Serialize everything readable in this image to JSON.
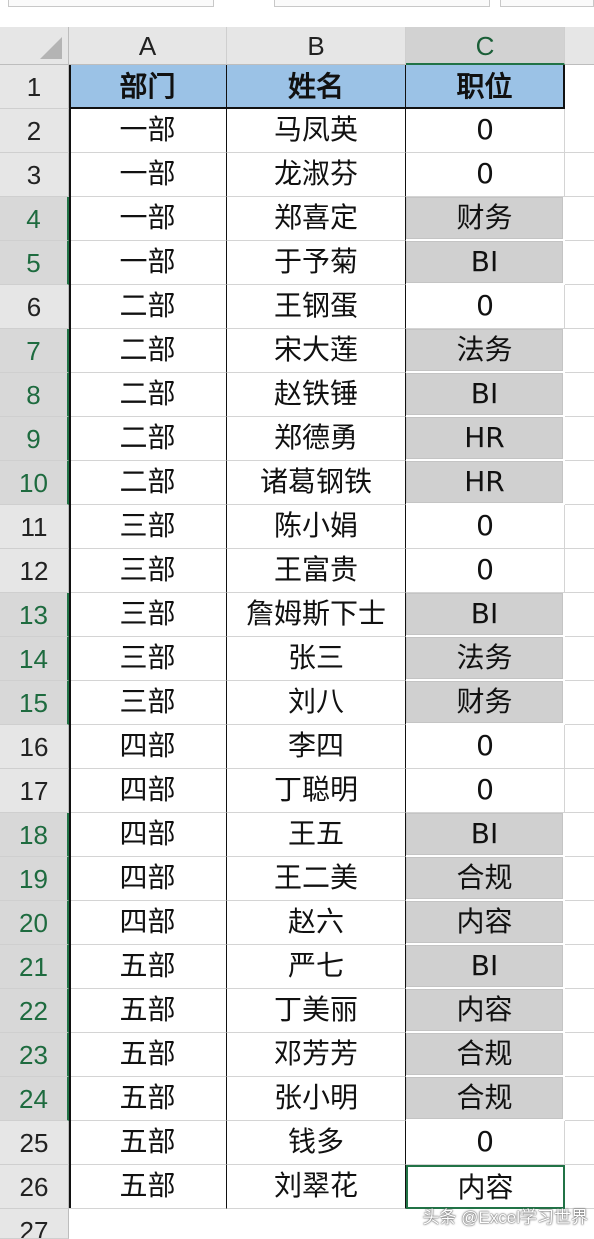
{
  "columns": [
    "A",
    "B",
    "C"
  ],
  "header": {
    "row": "1",
    "a": "部门",
    "b": "姓名",
    "c": "职位"
  },
  "rows": [
    {
      "n": "2",
      "a": "一部",
      "b": "马凤英",
      "c": "0",
      "hl": false
    },
    {
      "n": "3",
      "a": "一部",
      "b": "龙淑芬",
      "c": "0",
      "hl": false
    },
    {
      "n": "4",
      "a": "一部",
      "b": "郑喜定",
      "c": "财务",
      "hl": true
    },
    {
      "n": "5",
      "a": "一部",
      "b": "于予菊",
      "c": "BI",
      "hl": true
    },
    {
      "n": "6",
      "a": "二部",
      "b": "王钢蛋",
      "c": "0",
      "hl": false
    },
    {
      "n": "7",
      "a": "二部",
      "b": "宋大莲",
      "c": "法务",
      "hl": true
    },
    {
      "n": "8",
      "a": "二部",
      "b": "赵铁锤",
      "c": "BI",
      "hl": true
    },
    {
      "n": "9",
      "a": "二部",
      "b": "郑德勇",
      "c": "HR",
      "hl": true
    },
    {
      "n": "10",
      "a": "二部",
      "b": "诸葛钢铁",
      "c": "HR",
      "hl": true
    },
    {
      "n": "11",
      "a": "三部",
      "b": "陈小娟",
      "c": "0",
      "hl": false
    },
    {
      "n": "12",
      "a": "三部",
      "b": "王富贵",
      "c": "0",
      "hl": false
    },
    {
      "n": "13",
      "a": "三部",
      "b": "詹姆斯下士",
      "c": "BI",
      "hl": true
    },
    {
      "n": "14",
      "a": "三部",
      "b": "张三",
      "c": "法务",
      "hl": true
    },
    {
      "n": "15",
      "a": "三部",
      "b": "刘八",
      "c": "财务",
      "hl": true
    },
    {
      "n": "16",
      "a": "四部",
      "b": "李四",
      "c": "0",
      "hl": false
    },
    {
      "n": "17",
      "a": "四部",
      "b": "丁聪明",
      "c": "0",
      "hl": false
    },
    {
      "n": "18",
      "a": "四部",
      "b": "王五",
      "c": "BI",
      "hl": true
    },
    {
      "n": "19",
      "a": "四部",
      "b": "王二美",
      "c": "合规",
      "hl": true
    },
    {
      "n": "20",
      "a": "四部",
      "b": "赵六",
      "c": "内容",
      "hl": true
    },
    {
      "n": "21",
      "a": "五部",
      "b": "严七",
      "c": "BI",
      "hl": true
    },
    {
      "n": "22",
      "a": "五部",
      "b": "丁美丽",
      "c": "内容",
      "hl": true
    },
    {
      "n": "23",
      "a": "五部",
      "b": "邓芳芳",
      "c": "合规",
      "hl": true
    },
    {
      "n": "24",
      "a": "五部",
      "b": "张小明",
      "c": "合规",
      "hl": true
    },
    {
      "n": "25",
      "a": "五部",
      "b": "钱多",
      "c": "0",
      "hl": false
    },
    {
      "n": "26",
      "a": "五部",
      "b": "刘翠花",
      "c": "内容",
      "hl": false,
      "active": true
    }
  ],
  "next_row": "27",
  "watermark": "头条 @Excel学习世界",
  "colors": {
    "header_fill": "#9bc2e6",
    "highlight_fill": "#d0d0d0",
    "select_accent": "#217346"
  }
}
